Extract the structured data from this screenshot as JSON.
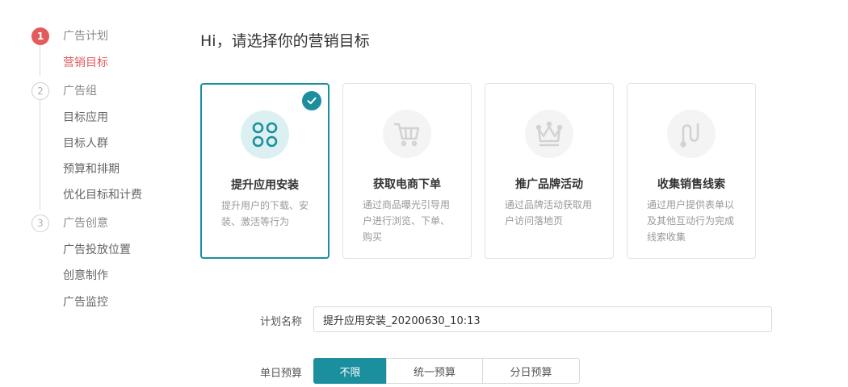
{
  "sidebar": {
    "steps": [
      {
        "number": "1",
        "label": "广告计划",
        "items": [
          "营销目标"
        ]
      },
      {
        "number": "2",
        "label": "广告组",
        "items": [
          "目标应用",
          "目标人群",
          "预算和排期",
          "优化目标和计费"
        ]
      },
      {
        "number": "3",
        "label": "广告创意",
        "items": [
          "广告投放位置",
          "创意制作",
          "广告监控"
        ]
      }
    ]
  },
  "main": {
    "title": "Hi，请选择你的营销目标",
    "cards": [
      {
        "title": "提升应用安装",
        "desc": "提升用户的下载、安装、激活等行为",
        "icon": "app-grid-icon",
        "selected": true
      },
      {
        "title": "获取电商下单",
        "desc": "通过商品曝光引导用户进行浏览、下单、购买",
        "icon": "cart-icon",
        "selected": false
      },
      {
        "title": "推广品牌活动",
        "desc": "通过品牌活动获取用户访问落地页",
        "icon": "crown-icon",
        "selected": false
      },
      {
        "title": "收集销售线索",
        "desc": "通过用户提供表单以及其他互动行为完成线索收集",
        "icon": "lead-path-icon",
        "selected": false
      }
    ]
  },
  "form": {
    "plan_name_label": "计划名称",
    "plan_name_value": "提升应用安装_20200630_10:13",
    "budget_label": "单日预算",
    "budget_options": [
      "不限",
      "统一预算",
      "分日预算"
    ],
    "budget_selected": "不限"
  },
  "colors": {
    "accent": "#1b8f9e",
    "step_active": "#e25c5c",
    "icon_gray": "#d6d6d8"
  }
}
